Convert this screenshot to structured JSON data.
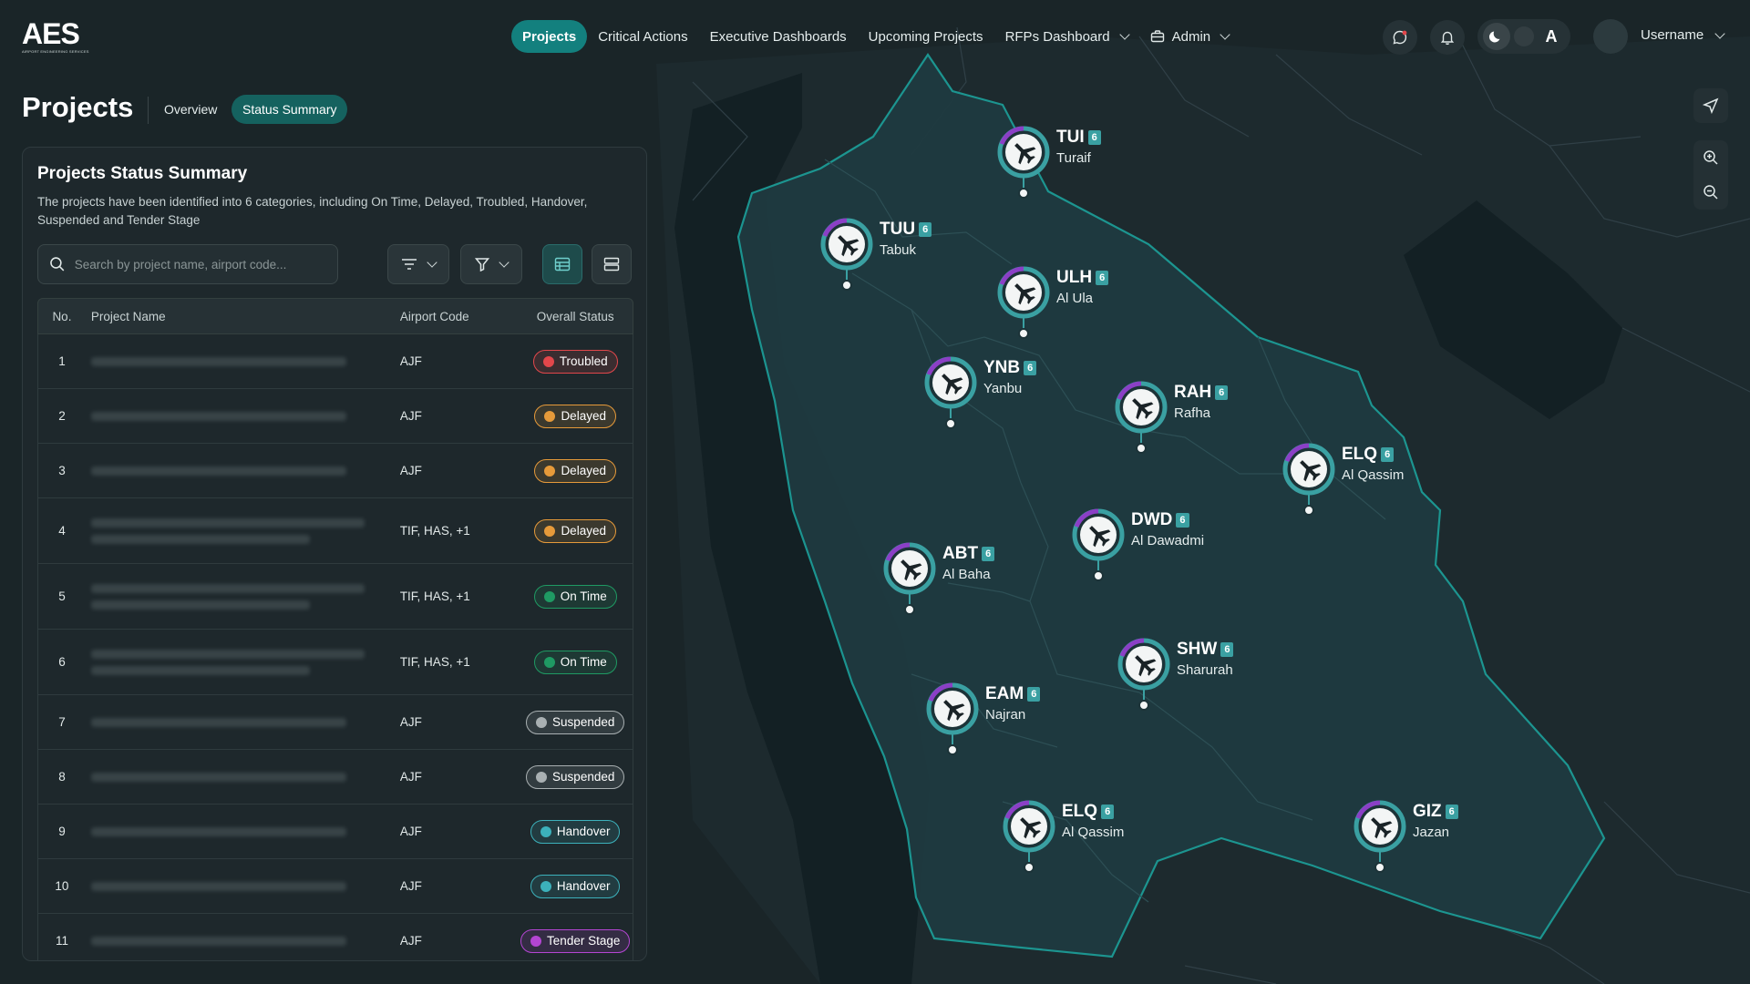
{
  "brand": {
    "logo_text": "AES",
    "logo_subtitle": "AIRPORT ENGINEERING SERVICES"
  },
  "nav": {
    "items": [
      {
        "label": "Projects",
        "active": true
      },
      {
        "label": "Critical Actions"
      },
      {
        "label": "Executive Dashboards"
      },
      {
        "label": "Upcoming Projects"
      },
      {
        "label": "RFPs Dashboard",
        "dropdown": true
      },
      {
        "label": "Admin",
        "dropdown": true,
        "icon": "briefcase-icon"
      }
    ]
  },
  "header_actions": {
    "username": "Username"
  },
  "page": {
    "title": "Projects",
    "tabs": [
      {
        "label": "Overview"
      },
      {
        "label": "Status Summary",
        "active": true
      }
    ]
  },
  "panel": {
    "title": "Projects Status Summary",
    "description": "The projects have been identified into 6 categories, including On Time, Delayed, Troubled, Handover, Suspended and Tender Stage",
    "search_placeholder": "Search by project name, airport code...",
    "columns": {
      "no": "No.",
      "name": "Project Name",
      "code": "Airport Code",
      "status": "Overall Status"
    },
    "rows": [
      {
        "no": "1",
        "code": "AJF",
        "status": "Troubled"
      },
      {
        "no": "2",
        "code": "AJF",
        "status": "Delayed"
      },
      {
        "no": "3",
        "code": "AJF",
        "status": "Delayed"
      },
      {
        "no": "4",
        "code": "TIF, HAS, +1",
        "status": "Delayed"
      },
      {
        "no": "5",
        "code": "TIF, HAS, +1",
        "status": "On Time"
      },
      {
        "no": "6",
        "code": "TIF, HAS, +1",
        "status": "On Time"
      },
      {
        "no": "7",
        "code": "AJF",
        "status": "Suspended"
      },
      {
        "no": "8",
        "code": "AJF",
        "status": "Suspended"
      },
      {
        "no": "9",
        "code": "AJF",
        "status": "Handover"
      },
      {
        "no": "10",
        "code": "AJF",
        "status": "Handover"
      },
      {
        "no": "11",
        "code": "AJF",
        "status": "Tender Stage"
      }
    ]
  },
  "status_colors": {
    "Troubled": "#e2474b",
    "Delayed": "#e69a3a",
    "On Time": "#1f9a63",
    "Suspended": "#a9b0b2",
    "Handover": "#3cb1bb",
    "Tender Stage": "#b445d3"
  },
  "map": {
    "airports": [
      {
        "code": "TUI",
        "city": "Turaif",
        "count": "6"
      },
      {
        "code": "TUU",
        "city": "Tabuk",
        "count": "6"
      },
      {
        "code": "ULH",
        "city": "Al Ula",
        "count": "6"
      },
      {
        "code": "YNB",
        "city": "Yanbu",
        "count": "6"
      },
      {
        "code": "RAH",
        "city": "Rafha",
        "count": "6"
      },
      {
        "code": "ELQ",
        "city": "Al Qassim",
        "count": "6"
      },
      {
        "code": "DWD",
        "city": "Al Dawadmi",
        "count": "6"
      },
      {
        "code": "ABT",
        "city": "Al Baha",
        "count": "6"
      },
      {
        "code": "SHW",
        "city": "Sharurah",
        "count": "6"
      },
      {
        "code": "EAM",
        "city": "Najran",
        "count": "6"
      },
      {
        "code": "ELQ",
        "city": "Al Qassim",
        "count": "6"
      },
      {
        "code": "GIZ",
        "city": "Jazan",
        "count": "6"
      }
    ]
  },
  "colors": {
    "accent": "#13807e",
    "region_fill": "#1f3a40",
    "region_stroke": "#1c9b96",
    "marker_teal": "#3aa0a2",
    "marker_purple": "#8b3fc6"
  }
}
